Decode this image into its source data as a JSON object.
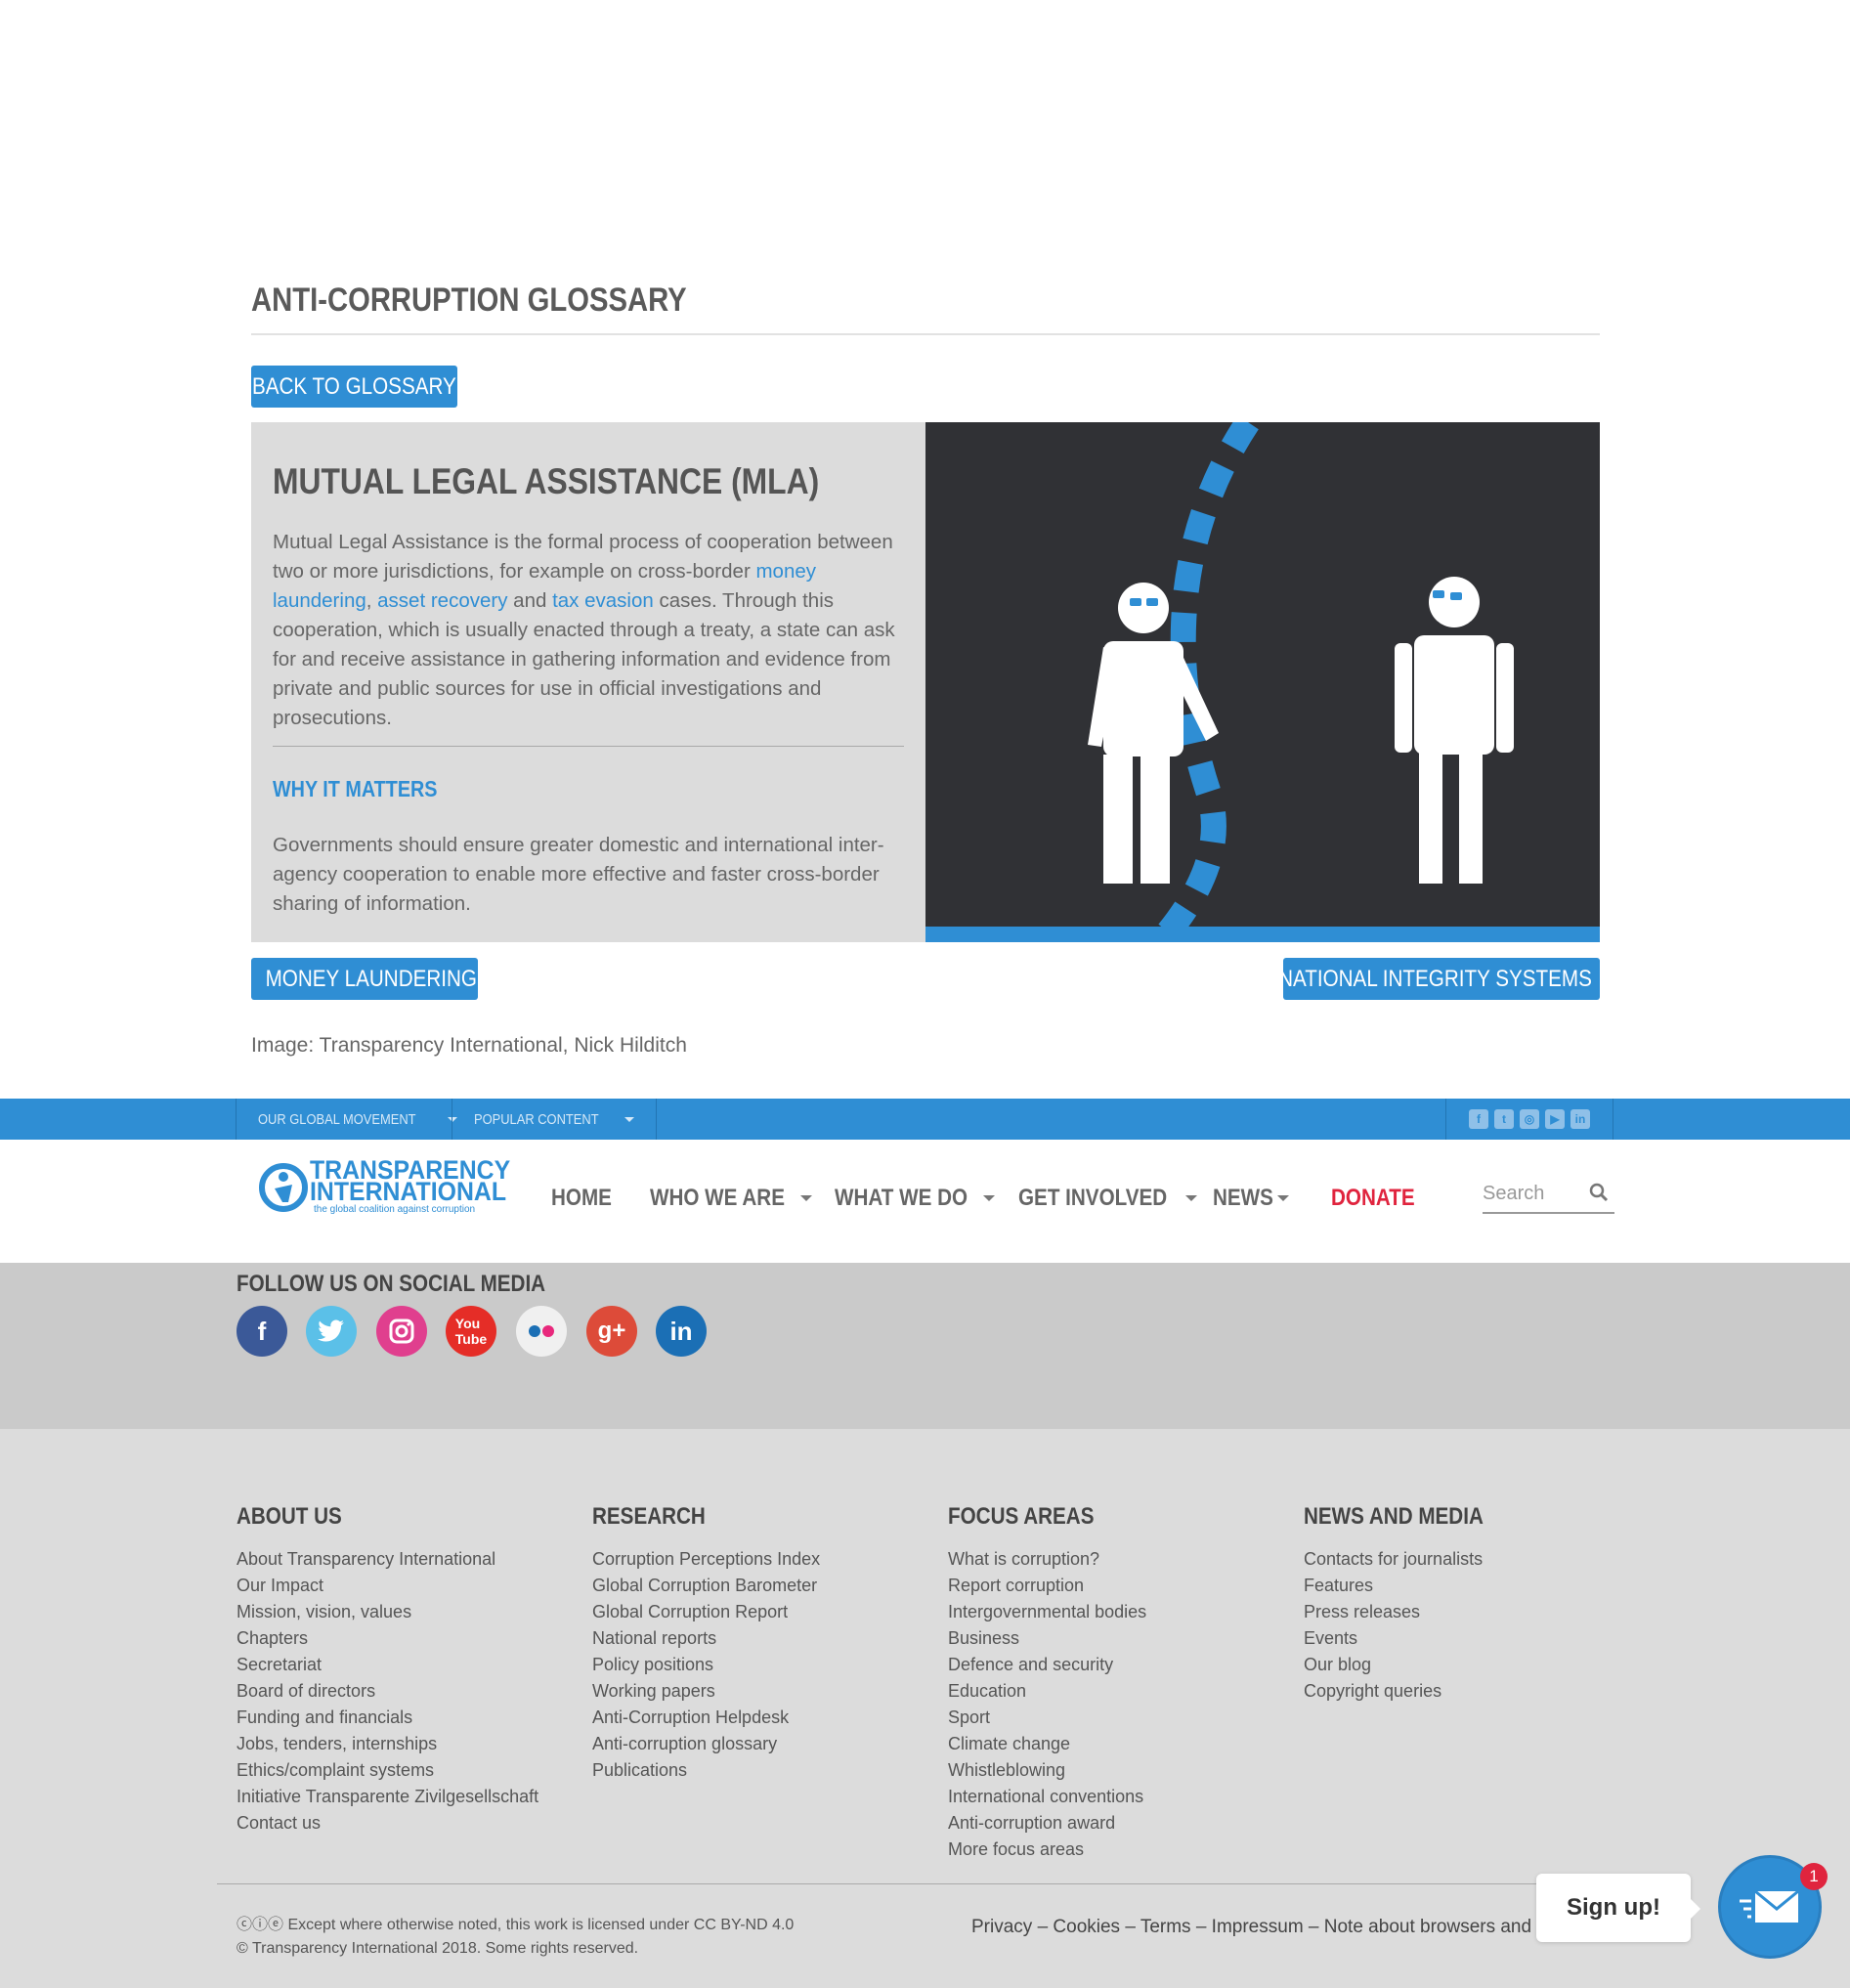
{
  "page": {
    "glossary_title": "ANTI-CORRUPTION GLOSSARY",
    "back_button": "BACK TO GLOSSARY"
  },
  "term": {
    "title": "MUTUAL LEGAL ASSISTANCE (MLA)",
    "definition_part1": "Mutual Legal Assistance is the formal process of cooperation between two or more jurisdictions, for example on cross-border ",
    "link_money_laundering": "money laundering",
    "sep_comma": ", ",
    "link_asset_recovery": "asset recovery",
    "sep_and": " and ",
    "link_tax_evasion": "tax evasion",
    "definition_part2": " cases. Through this cooperation, which is usually enacted through a treaty, a state can ask for and receive assistance in gathering information and evidence from private and public sources for use in official investigations and prosecutions.",
    "why_title": "WHY IT MATTERS",
    "why_text": "Governments should ensure greater domestic and international inter-agency cooperation to enable more effective and faster cross-border sharing of information."
  },
  "pager": {
    "prev_label": "MONEY LAUNDERING",
    "next_label": "NATIONAL INTEGRITY SYSTEMS"
  },
  "image_credit": "Image: Transparency International, Nick Hilditch",
  "util_bar": {
    "item1": "OUR GLOBAL MOVEMENT",
    "item2": "POPULAR CONTENT",
    "social_icons": [
      "facebook-icon",
      "twitter-icon",
      "instagram-icon",
      "youtube-icon",
      "linkedin-icon"
    ]
  },
  "nav": {
    "logo_line1": "TRANSPARENCY",
    "logo_line2": "INTERNATIONAL",
    "logo_tagline": "the global coalition against corruption",
    "home": "HOME",
    "who": "WHO WE ARE",
    "what": "WHAT WE DO",
    "involved": "GET INVOLVED",
    "news": "NEWS",
    "donate": "DONATE",
    "search_placeholder": "Search"
  },
  "social": {
    "title": "FOLLOW US ON SOCIAL MEDIA",
    "icons": [
      {
        "name": "facebook-icon",
        "color": "#3b5998"
      },
      {
        "name": "twitter-icon",
        "color": "#5bc0e8"
      },
      {
        "name": "instagram-icon",
        "color": "#e03f8e"
      },
      {
        "name": "youtube-icon",
        "color": "#e52d27"
      },
      {
        "name": "flickr-icon",
        "color": "#f0f0f0"
      },
      {
        "name": "googleplus-icon",
        "color": "#dd4b39"
      },
      {
        "name": "linkedin-icon",
        "color": "#1b6fb5"
      }
    ]
  },
  "footer": {
    "about": {
      "title": "ABOUT US",
      "items": [
        "About Transparency International",
        "Our Impact",
        "Mission, vision, values",
        "Chapters",
        "Secretariat",
        "Board of directors",
        "Funding and financials",
        "Jobs, tenders, internships",
        "Ethics/complaint systems",
        "Initiative Transparente Zivilgesellschaft",
        "Contact us"
      ]
    },
    "research": {
      "title": "RESEARCH",
      "items": [
        "Corruption Perceptions Index",
        "Global Corruption Barometer",
        "Global Corruption Report",
        "National reports",
        "Policy positions",
        "Working papers",
        "Anti-Corruption Helpdesk",
        "Anti-corruption glossary",
        "Publications"
      ]
    },
    "focus": {
      "title": "FOCUS AREAS",
      "items": [
        "What is corruption?",
        "Report corruption",
        "Intergovernmental bodies",
        "Business",
        "Defence and security",
        "Education",
        "Sport",
        "Climate change",
        "Whistleblowing",
        "International conventions",
        "Anti-corruption award",
        "More focus areas"
      ]
    },
    "news": {
      "title": "NEWS AND MEDIA",
      "items": [
        "Contacts for journalists",
        "Features",
        "Press releases",
        "Events",
        "Our blog",
        "Copyright queries"
      ]
    },
    "license_line1": "Except where otherwise noted, this work is licensed under CC BY-ND 4.0",
    "license_line2": "© Transparency International 2018. Some rights reserved.",
    "legal_links": "Privacy – Cookies – Terms – Impressum – Note about browsers and"
  },
  "widget": {
    "signup": "Sign up!",
    "badge_count": "1"
  },
  "colors": {
    "brand_blue": "#2f8ed4",
    "donate_red": "#e0243e",
    "image_bg": "#303135"
  }
}
